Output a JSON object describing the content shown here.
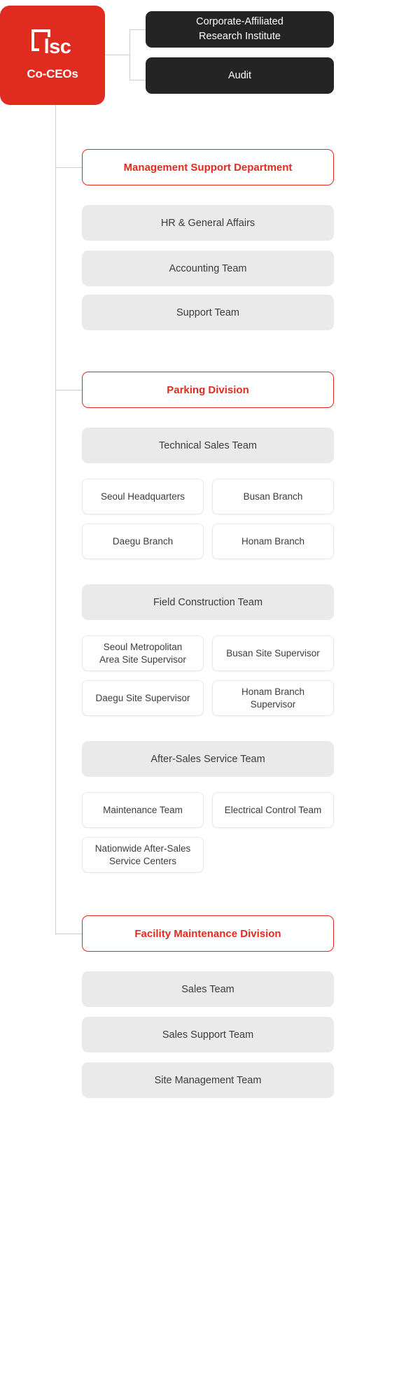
{
  "colors": {
    "brand_red": "#E02B20",
    "staff_dark": "#242424",
    "team_gray": "#EAEAEA",
    "text_dark": "#3c3c3c",
    "connector": "#cfcfcf"
  },
  "root": {
    "logo_icon": "lsc-bracket-logo",
    "logo_wordmark": "lsc",
    "title": "Co-CEOs"
  },
  "staff_units": [
    {
      "label": "Corporate-Affiliated\nResearch Institute",
      "line1": "Corporate-Affiliated",
      "line2": "Research Institute"
    },
    {
      "label": "Audit",
      "line1": "Audit",
      "line2": ""
    }
  ],
  "divisions": [
    {
      "name": "Management Support Department",
      "teams": [
        {
          "name": "HR & General Affairs",
          "units": []
        },
        {
          "name": "Accounting Team",
          "units": []
        },
        {
          "name": "Support Team",
          "units": []
        }
      ]
    },
    {
      "name": "Parking Division",
      "teams": [
        {
          "name": "Technical Sales Team",
          "units": [
            {
              "line1": "Seoul Headquarters",
              "line2": ""
            },
            {
              "line1": "Busan Branch",
              "line2": ""
            },
            {
              "line1": "Daegu Branch",
              "line2": ""
            },
            {
              "line1": "Honam Branch",
              "line2": ""
            }
          ]
        },
        {
          "name": "Field Construction Team",
          "units": [
            {
              "line1": "Seoul Metropolitan",
              "line2": "Area Site Supervisor"
            },
            {
              "line1": "Busan Site Supervisor",
              "line2": ""
            },
            {
              "line1": "Daegu Site Supervisor",
              "line2": ""
            },
            {
              "line1": "Honam Branch",
              "line2": "Supervisor"
            }
          ]
        },
        {
          "name": "After-Sales Service Team",
          "units": [
            {
              "line1": "Maintenance Team",
              "line2": ""
            },
            {
              "line1": "Electrical Control Team",
              "line2": ""
            },
            {
              "line1": "Nationwide After-Sales",
              "line2": "Service Centers"
            }
          ]
        }
      ]
    },
    {
      "name": "Facility Maintenance Division",
      "teams": [
        {
          "name": "Sales Team",
          "units": []
        },
        {
          "name": "Sales Support Team",
          "units": []
        },
        {
          "name": "Site Management Team",
          "units": []
        }
      ]
    }
  ]
}
